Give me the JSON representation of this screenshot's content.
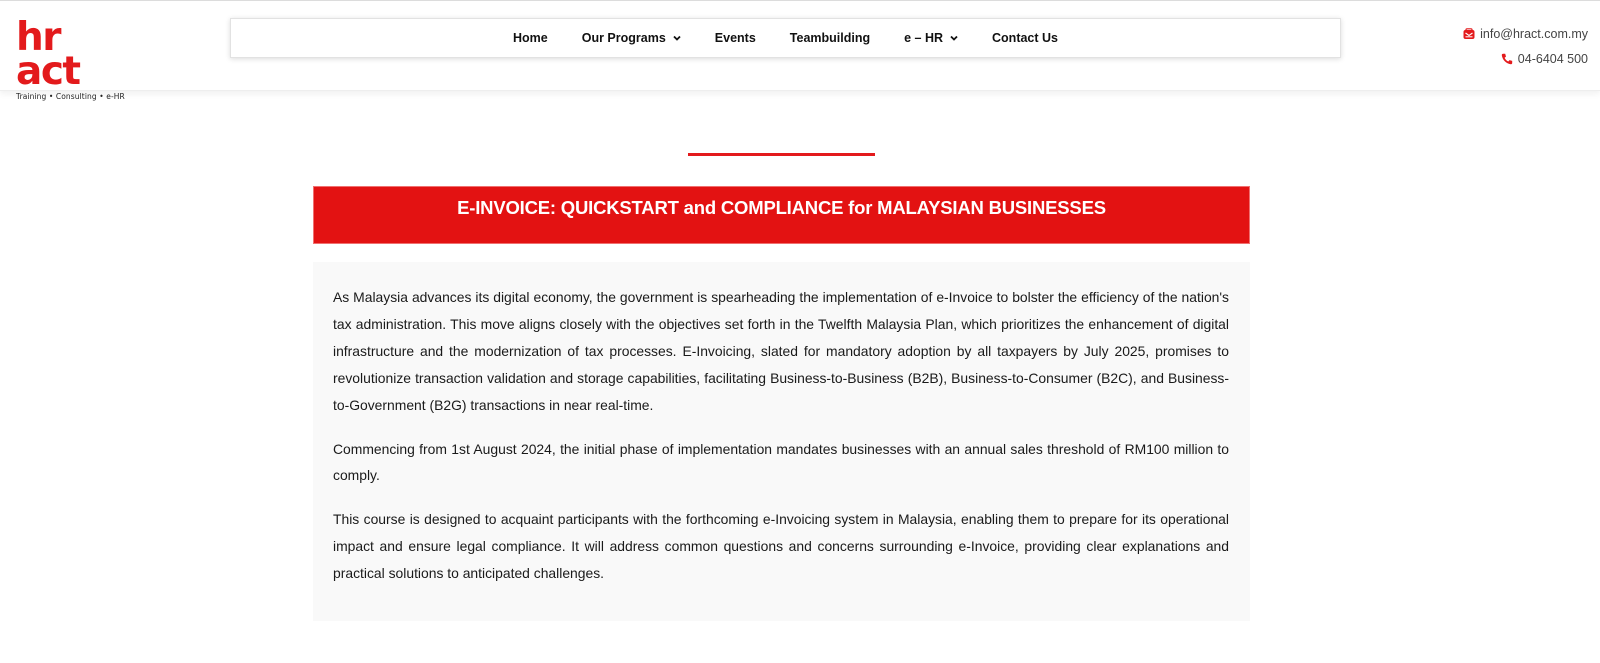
{
  "header": {
    "logo": {
      "wordmark": "hr act",
      "tagline": "Training • Consulting • e-HR"
    },
    "nav": [
      {
        "label": "Home",
        "has_dropdown": false
      },
      {
        "label": "Our Programs",
        "has_dropdown": true
      },
      {
        "label": "Events",
        "has_dropdown": false
      },
      {
        "label": "Teambuilding",
        "has_dropdown": false
      },
      {
        "label": "e – HR",
        "has_dropdown": true
      },
      {
        "label": "Contact Us",
        "has_dropdown": false
      }
    ],
    "contact": {
      "email": "info@hract.com.my",
      "email_icon": "envelope-icon",
      "phone": "04-6404 500",
      "phone_icon": "phone-icon"
    }
  },
  "colors": {
    "brand_red": "#e31a1c",
    "title_bar": "#e31212",
    "content_bg": "#f9f9f9"
  },
  "main": {
    "title": "E-INVOICE: QUICKSTART and COMPLIANCE for MALAYSIAN BUSINESSES",
    "paragraphs": [
      "As Malaysia advances its digital economy, the government is spearheading the implementation of e-Invoice to bolster the efficiency of the nation's tax administration. This move aligns closely with the objectives set forth in the Twelfth Malaysia Plan, which prioritizes the enhancement of digital infrastructure and the modernization of tax processes. E-Invoicing, slated for mandatory adoption by all taxpayers by July 2025, promises to revolutionize transaction validation and storage capabilities, facilitating Business-to-Business (B2B), Business-to-Consumer (B2C), and Business-to-Government (B2G) transactions in near real-time.",
      "Commencing from 1st August 2024, the initial phase of implementation mandates businesses with an annual sales threshold of RM100 million to comply.",
      "This course is designed to acquaint participants with the forthcoming e-Invoicing system in Malaysia, enabling them to prepare for its operational impact and ensure legal compliance. It will address common questions and concerns surrounding e-Invoice, providing clear explanations and practical solutions to anticipated challenges."
    ]
  }
}
